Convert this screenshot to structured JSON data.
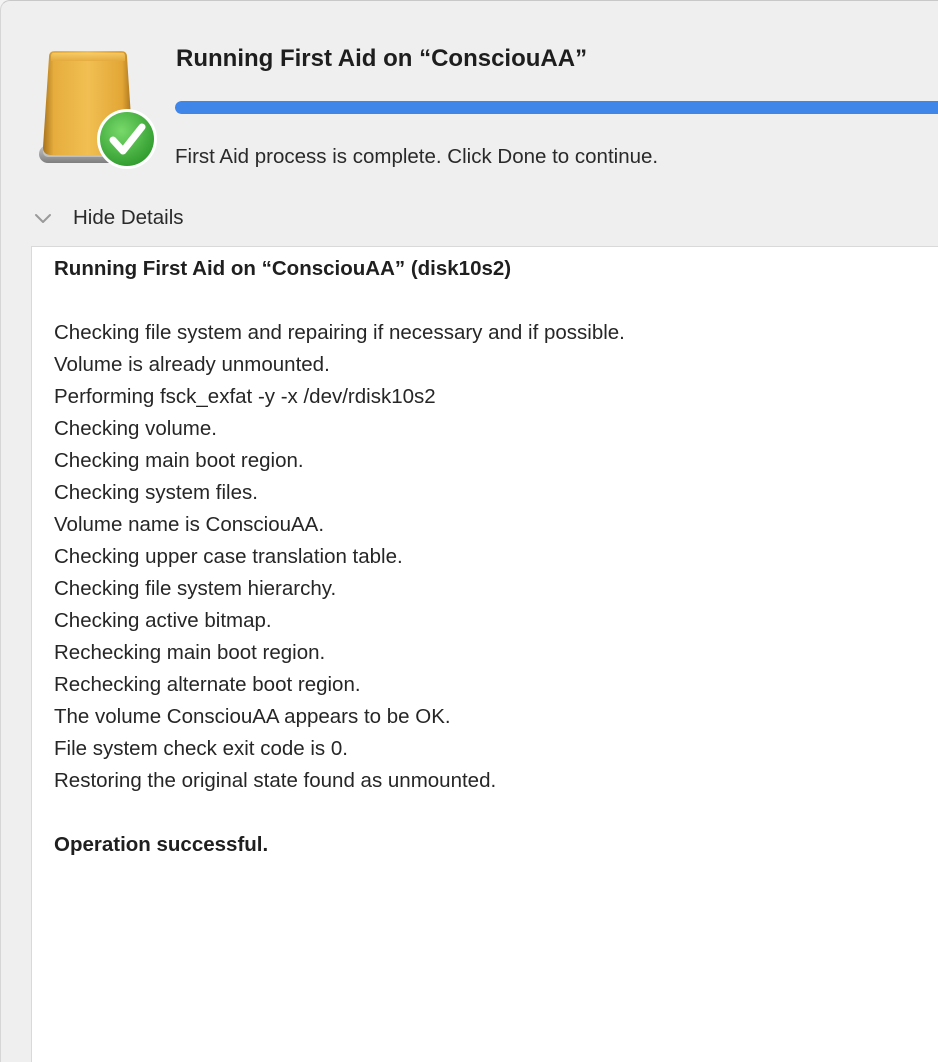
{
  "dialog": {
    "title": "Running First Aid on “ConsciouAA”",
    "progress": 1.0,
    "status": "First Aid process is complete. Click Done to continue.",
    "details_toggle_label": "Hide Details",
    "icons": {
      "drive": "external-drive-icon",
      "check": "checkmark-badge-icon",
      "toggle": "chevron-down-icon"
    },
    "colors": {
      "accent": "#3f86e8",
      "drive": "#e0a030",
      "success": "#3fae3a"
    }
  },
  "log": {
    "lines": [
      {
        "text": "Running First Aid on “ConsciouAA” (disk10s2)",
        "bold": true
      },
      {
        "text": "",
        "bold": false
      },
      {
        "text": "Checking file system and repairing if necessary and if possible.",
        "bold": false
      },
      {
        "text": "Volume is already unmounted.",
        "bold": false
      },
      {
        "text": "Performing fsck_exfat -y -x /dev/rdisk10s2",
        "bold": false
      },
      {
        "text": "Checking volume.",
        "bold": false
      },
      {
        "text": "Checking main boot region.",
        "bold": false
      },
      {
        "text": "Checking system files.",
        "bold": false
      },
      {
        "text": "Volume name is ConsciouAA.",
        "bold": false
      },
      {
        "text": "Checking upper case translation table.",
        "bold": false
      },
      {
        "text": "Checking file system hierarchy.",
        "bold": false
      },
      {
        "text": "Checking active bitmap.",
        "bold": false
      },
      {
        "text": "Rechecking main boot region.",
        "bold": false
      },
      {
        "text": "Rechecking alternate boot region.",
        "bold": false
      },
      {
        "text": "The volume ConsciouAA appears to be OK.",
        "bold": false
      },
      {
        "text": "File system check exit code is 0.",
        "bold": false
      },
      {
        "text": "Restoring the original state found as unmounted.",
        "bold": false
      },
      {
        "text": "",
        "bold": false
      },
      {
        "text": "Operation successful.",
        "bold": true
      }
    ]
  }
}
